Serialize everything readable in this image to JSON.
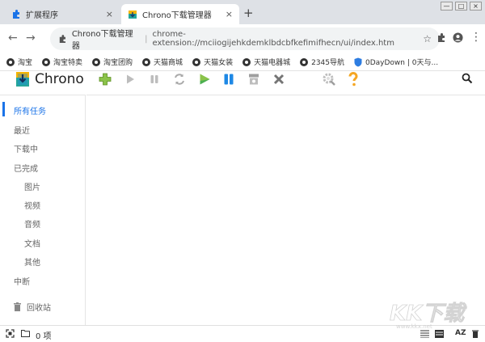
{
  "browser": {
    "tabs": [
      {
        "label": "扩展程序",
        "close": "×"
      },
      {
        "label": "Chrono下载管理器",
        "close": "×"
      }
    ],
    "new_tab": "+",
    "window_buttons": [
      "—",
      "□",
      "×"
    ],
    "page_name": "Chrono下载管理器",
    "url": "chrome-extension://mciiogijehkdemklbdcbfkefimifhecn/ui/index.htm",
    "bookmarks": [
      "淘宝",
      "淘宝特卖",
      "淘宝团购",
      "天猫商城",
      "天猫女装",
      "天猫电器城",
      "2345导航",
      "0DayDown | 0天与..."
    ]
  },
  "app": {
    "title": "Chrono",
    "toolbar_icons": [
      "add-icon",
      "play-icon",
      "pause-icon",
      "refresh-icon",
      "start-all-icon",
      "pause-all-icon",
      "clear-icon",
      "delete-icon",
      "settings-icon",
      "help-icon",
      "search-icon"
    ],
    "sidebar": {
      "all": "所有任务",
      "recent": "最近",
      "downloading": "下载中",
      "completed": "已完成",
      "images": "图片",
      "videos": "视频",
      "audio": "音频",
      "documents": "文档",
      "other": "其他",
      "interrupted": "中断",
      "trash": "回收站"
    },
    "footer": {
      "count": "0 项",
      "sort_label": "AZ"
    }
  },
  "colors": {
    "accent": "#1a73e8",
    "add_green": "#8bc34a",
    "play_green": "#4caf50",
    "pause_blue": "#1e88e5",
    "help_orange": "#f5a623",
    "tab_bar": "#dee1e6"
  },
  "watermark": {
    "text": "KK下载",
    "sub": "www.kkx.net"
  }
}
